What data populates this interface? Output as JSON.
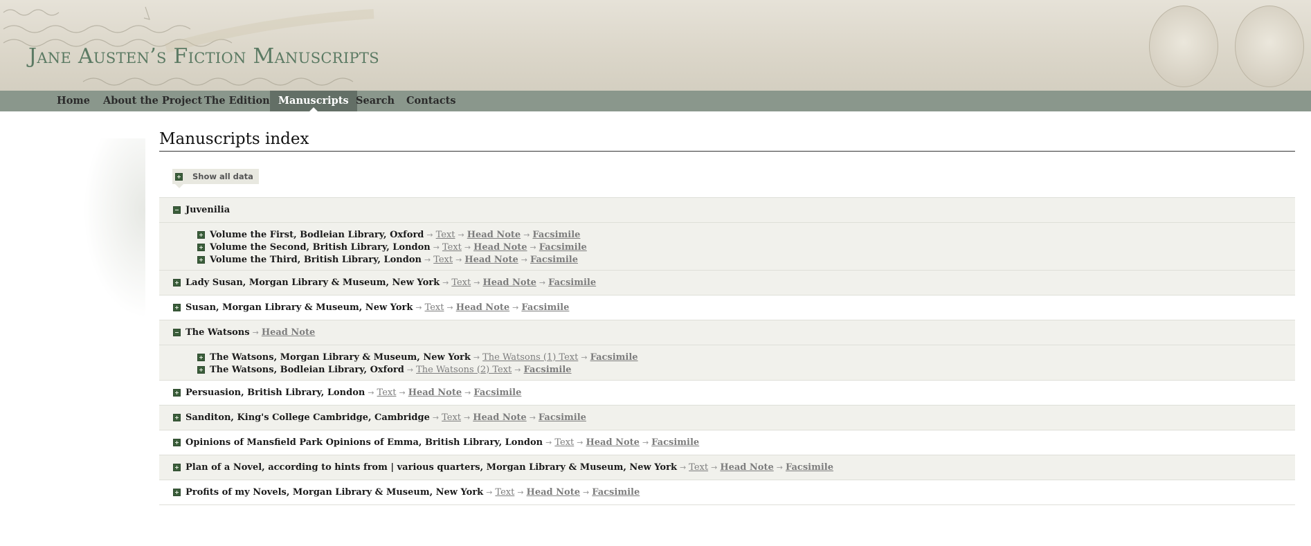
{
  "site": {
    "title": "Jane Austen’s Fiction Manuscripts"
  },
  "nav": {
    "items": [
      {
        "label": "Home"
      },
      {
        "label": "About the Project"
      },
      {
        "label": "The Edition"
      },
      {
        "label": "Manuscripts",
        "active": true
      },
      {
        "label": "Search"
      },
      {
        "label": "Contacts"
      }
    ]
  },
  "main": {
    "title": "Manuscripts index",
    "show_all_label": "Show all data"
  },
  "tree": {
    "juvenilia": {
      "label": "Juvenilia",
      "children": [
        {
          "name": "Volume the First, Bodleian Library, Oxford",
          "text": "Text",
          "head_note": "Head Note",
          "facsimile": "Facsimile"
        },
        {
          "name": "Volume the Second, British Library, London",
          "text": "Text",
          "head_note": "Head Note",
          "facsimile": "Facsimile"
        },
        {
          "name": "Volume the Third, British Library, London",
          "text": "Text",
          "head_note": "Head Note",
          "facsimile": "Facsimile"
        }
      ]
    },
    "lady_susan": {
      "name": "Lady Susan, Morgan Library & Museum, New York",
      "text": "Text",
      "head_note": "Head Note",
      "facsimile": "Facsimile"
    },
    "susan": {
      "name": "Susan, Morgan Library & Museum, New York",
      "text": "Text",
      "head_note": "Head Note",
      "facsimile": "Facsimile"
    },
    "watsons": {
      "label": "The Watsons",
      "head_note": "Head Note",
      "children": [
        {
          "name": "The Watsons, Morgan Library & Museum, New York",
          "text": "The Watsons (1) Text",
          "facsimile": "Facsimile"
        },
        {
          "name": "The Watsons, Bodleian Library, Oxford",
          "text": "The Watsons (2) Text",
          "facsimile": "Facsimile"
        }
      ]
    },
    "persuasion": {
      "name": "Persuasion, British Library, London",
      "text": "Text",
      "head_note": "Head Note",
      "facsimile": "Facsimile"
    },
    "sanditon": {
      "name": "Sanditon, King's College Cambridge, Cambridge",
      "text": "Text",
      "head_note": "Head Note",
      "facsimile": "Facsimile"
    },
    "opinions": {
      "name": "Opinions of Mansfield Park Opinions of Emma, British Library, London",
      "text": "Text",
      "head_note": "Head Note",
      "facsimile": "Facsimile"
    },
    "plan": {
      "name": "Plan of a Novel, according to hints from | various quarters, Morgan Library & Museum, New York",
      "text": "Text",
      "head_note": "Head Note",
      "facsimile": "Facsimile"
    },
    "profits": {
      "name": "Profits of my Novels, Morgan Library & Museum, New York",
      "text": "Text",
      "head_note": "Head Note",
      "facsimile": "Facsimile"
    }
  },
  "colors": {
    "nav_bg": "#8a978c",
    "nav_active": "#636f66",
    "title_green": "#5b7a63",
    "row_shade": "#f1f1ec"
  },
  "icons": {
    "expand": "plus-box-icon",
    "collapse": "minus-box-icon",
    "separator": "arrow-right-icon"
  }
}
